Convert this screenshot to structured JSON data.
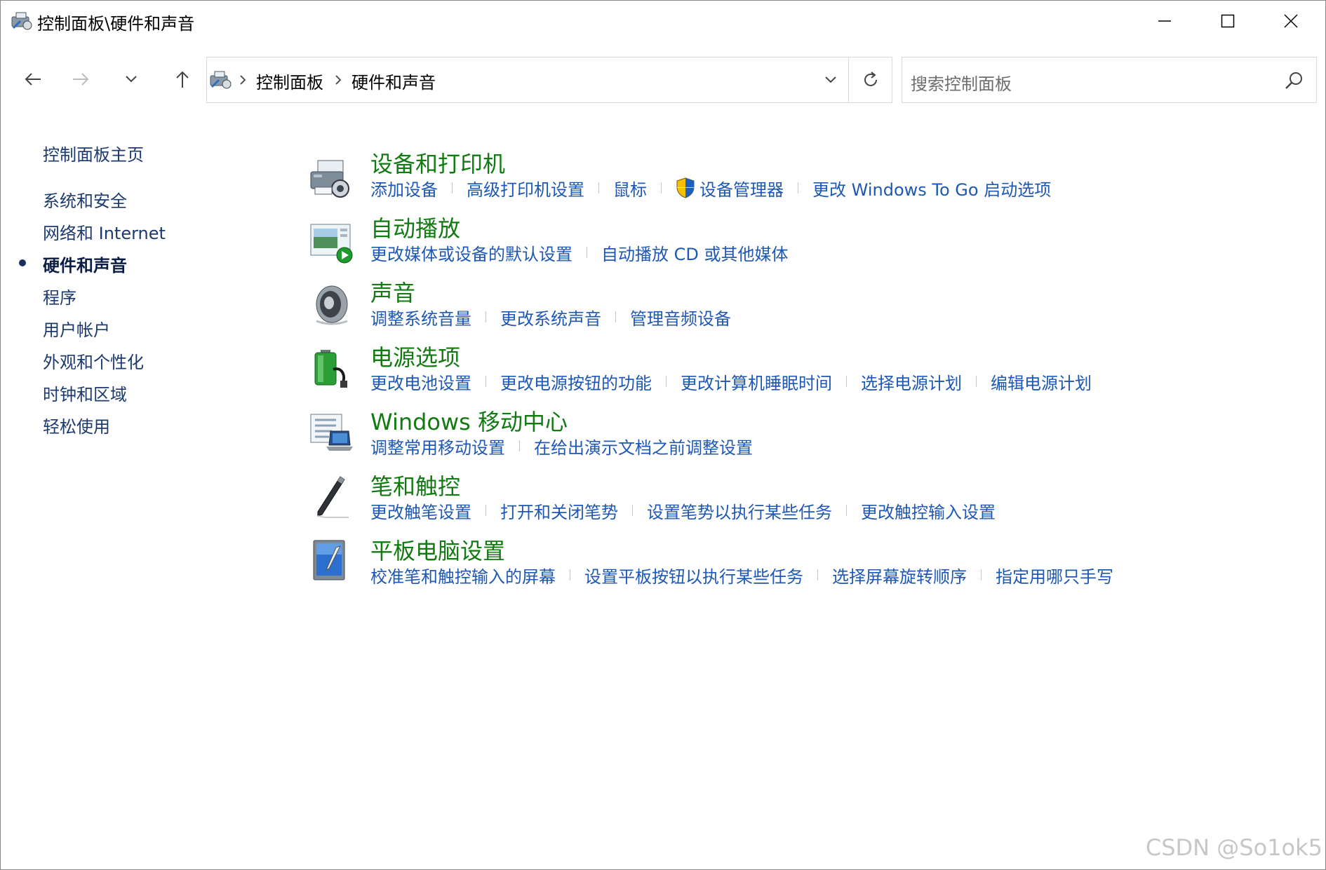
{
  "window": {
    "title": "控制面板\\硬件和声音"
  },
  "breadcrumb": {
    "items": [
      "控制面板",
      "硬件和声音"
    ]
  },
  "search": {
    "placeholder": "搜索控制面板"
  },
  "sidebar": {
    "home": "控制面板主页",
    "items": [
      {
        "label": "系统和安全"
      },
      {
        "label": "网络和 Internet"
      },
      {
        "label": "硬件和声音",
        "current": true
      },
      {
        "label": "程序"
      },
      {
        "label": "用户帐户"
      },
      {
        "label": "外观和个性化"
      },
      {
        "label": "时钟和区域"
      },
      {
        "label": "轻松使用"
      }
    ]
  },
  "categories": [
    {
      "title": "设备和打印机",
      "icon": "printer-icon",
      "links": [
        "添加设备",
        "高级打印机设置",
        "鼠标",
        "设备管理器",
        "更改 Windows To Go 启动选项"
      ]
    },
    {
      "title": "自动播放",
      "icon": "autoplay-icon",
      "links": [
        "更改媒体或设备的默认设置",
        "自动播放 CD 或其他媒体"
      ]
    },
    {
      "title": "声音",
      "icon": "speaker-icon",
      "links": [
        "调整系统音量",
        "更改系统声音",
        "管理音频设备"
      ]
    },
    {
      "title": "电源选项",
      "icon": "battery-icon",
      "links": [
        "更改电池设置",
        "更改电源按钮的功能",
        "更改计算机睡眠时间",
        "选择电源计划",
        "编辑电源计划"
      ]
    },
    {
      "title": "Windows 移动中心",
      "icon": "mobility-center-icon",
      "links": [
        "调整常用移动设置",
        "在给出演示文档之前调整设置"
      ]
    },
    {
      "title": "笔和触控",
      "icon": "pen-icon",
      "links": [
        "更改触笔设置",
        "打开和关闭笔势",
        "设置笔势以执行某些任务",
        "更改触控输入设置"
      ]
    },
    {
      "title": "平板电脑设置",
      "icon": "tablet-icon",
      "links": [
        "校准笔和触控输入的屏幕",
        "设置平板按钮以执行某些任务",
        "选择屏幕旋转顺序",
        "指定用哪只手写"
      ]
    }
  ],
  "watermark": "CSDN @So1ok5",
  "colors": {
    "category_title": "#117a11",
    "link": "#1e58b4",
    "sidebar_link": "#1c3a6e"
  }
}
